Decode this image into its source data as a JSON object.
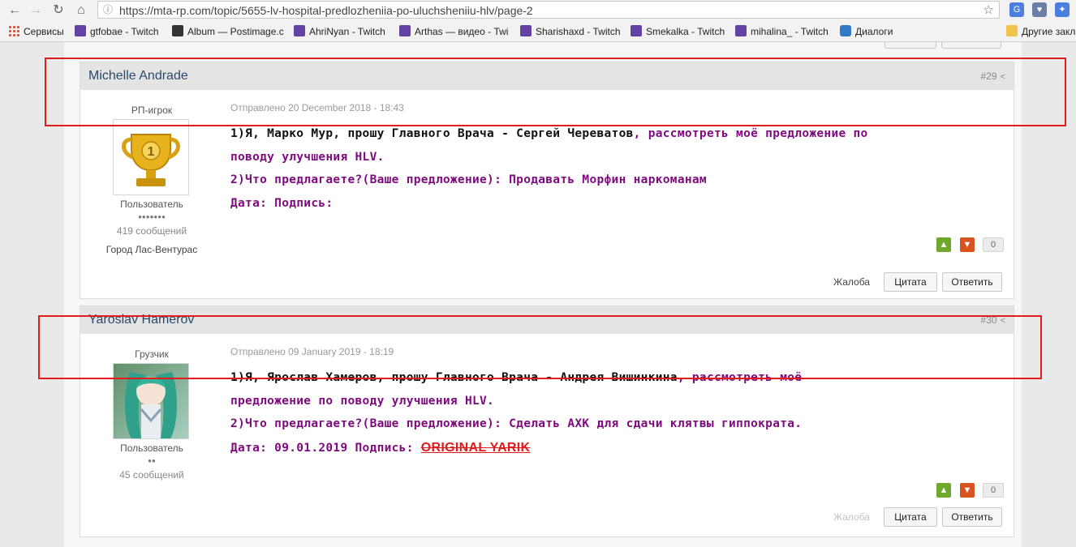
{
  "browser": {
    "url": "https://mta-rp.com/topic/5655-lv-hospital-predlozheniia-po-uluchsheniiu-hlv/page-2",
    "bookmarks": [
      {
        "label": "Сервисы",
        "icon": "apps-icon"
      },
      {
        "label": "gtfobae - Twitch",
        "icon": "twitch-icon"
      },
      {
        "label": "Album — Postimage.c",
        "icon": "postimage-icon"
      },
      {
        "label": "AhriNyan - Twitch",
        "icon": "twitch-icon"
      },
      {
        "label": "Arthas — видео - Twi",
        "icon": "twitch-icon"
      },
      {
        "label": "Sharishaxd - Twitch",
        "icon": "twitch-icon"
      },
      {
        "label": "Smekalka - Twitch",
        "icon": "twitch-icon"
      },
      {
        "label": "mihalina_ - Twitch",
        "icon": "twitch-icon"
      },
      {
        "label": "Диалоги",
        "icon": "dialogs-icon"
      }
    ],
    "other_bookmarks": "Другие закл"
  },
  "posts": [
    {
      "author": "Michelle Andrade",
      "number": "#29",
      "rank": "РП-игрок",
      "group": "Пользователь",
      "pips": "●●●●●●●",
      "count": "419 сообщений",
      "city": "Город Лас-Вентурас",
      "sent": "Отправлено 20 December 2018 - 18:43",
      "lines": [
        [
          {
            "t": "1)Я, Марко Мур, прошу Главного Врача - Сергей Череватов",
            "c": "black"
          },
          {
            "t": ", рассмотреть моё предложение по",
            "c": "purple"
          }
        ],
        [
          {
            "t": "поводу улучшения HLV.",
            "c": "purple"
          }
        ],
        [
          {
            "t": "2)Что предлагаете?(Ваше предложение): Продавать Морфин наркоманам",
            "c": "purple"
          }
        ],
        [
          {
            "t": "Дата: Подпись:",
            "c": "purple"
          }
        ]
      ],
      "rep": "0",
      "report": "Жалоба",
      "quote": "Цитата",
      "reply": "Ответить"
    },
    {
      "author": "Yaroslav Hamerov",
      "number": "#30",
      "rank": "Грузчик",
      "group": "Пользователь",
      "pips": "●●",
      "count": "45 сообщений",
      "sent": "Отправлено 09 January 2019 - 18:19",
      "lines": [
        [
          {
            "t": "1)Я, Ярослав Хамеров, прошу Главного Врача - Андрея Вишинкина",
            "c": "black"
          },
          {
            "t": ", рассмотреть моё",
            "c": "purple"
          }
        ],
        [
          {
            "t": "предложение по поводу улучшения HLV.",
            "c": "purple"
          }
        ],
        [
          {
            "t": "2)Что предлагаете?(Ваше предложение): Сделать АХК для сдачи клятвы гиппократа.",
            "c": "purple"
          }
        ],
        [
          {
            "t": "Дата: 09.01.2019 Подпись: ",
            "c": "purple"
          },
          {
            "t": "ORIGINAL YARIK",
            "c": "sig"
          }
        ]
      ],
      "rep": "0",
      "report": "Жалоба",
      "quote": "Цитата",
      "reply": "Ответить"
    }
  ],
  "colors": {
    "highlight": "#e21b1b",
    "author": "#2b4a6a",
    "purple_text": "#7f0a7f"
  }
}
